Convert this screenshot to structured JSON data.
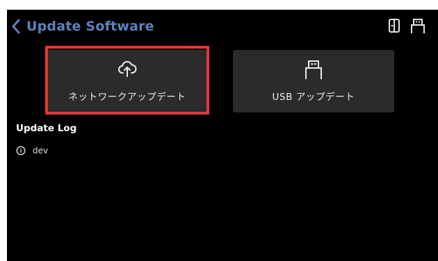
{
  "header": {
    "title": "Update Software",
    "back_icon": "chevron-left-icon",
    "icons": [
      "exit-door-icon",
      "usb-icon"
    ]
  },
  "options": [
    {
      "id": "network",
      "label": "ネットワークアップデート",
      "icon": "cloud-upload-icon",
      "highlighted": true
    },
    {
      "id": "usb",
      "label": "USB アップデート",
      "icon": "usb-icon",
      "highlighted": false
    }
  ],
  "log": {
    "title": "Update Log",
    "entries": [
      {
        "icon": "info-icon",
        "text": "dev"
      }
    ]
  },
  "colors": {
    "background": "#000000",
    "title": "#5e82bd",
    "tile": "#2b2b2b",
    "highlight": "#e8353a",
    "text": "#ffffff"
  }
}
